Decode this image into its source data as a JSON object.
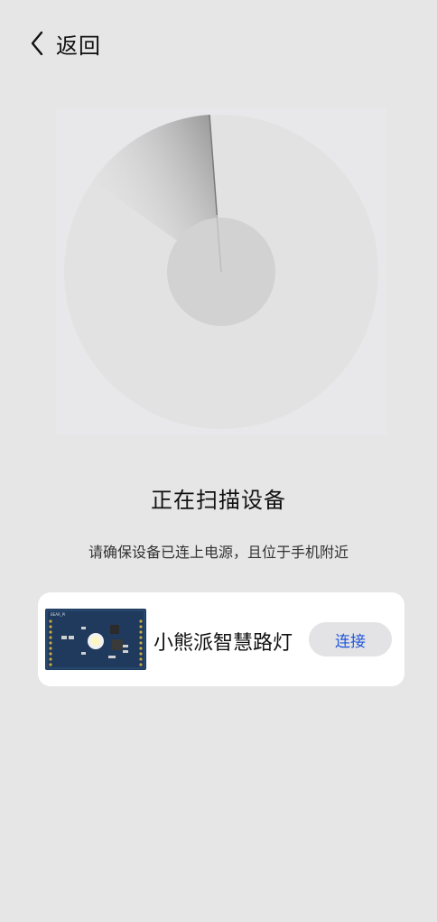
{
  "header": {
    "back_label": "返回"
  },
  "scan": {
    "title": "正在扫描设备",
    "subtitle": "请确保设备已连上电源，且位于手机附近"
  },
  "device": {
    "name": "小熊派智慧路灯",
    "connect_label": "连接",
    "thumb_label": "BEAR_PI"
  },
  "colors": {
    "background": "#e6e6e6",
    "radar_outer": "#e2e2e2",
    "radar_inner": "#d2d2d2",
    "accent": "#2156d8",
    "card": "#ffffff"
  }
}
